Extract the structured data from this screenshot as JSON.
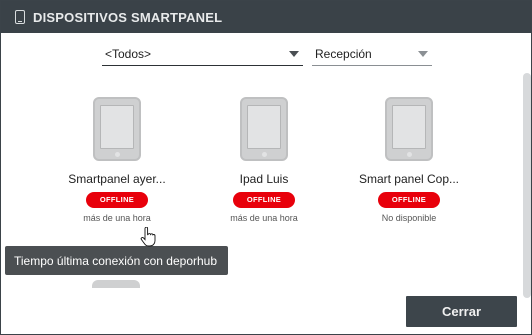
{
  "window": {
    "title": "DISPOSITIVOS SMARTPANEL",
    "title_icon": "tablet-icon"
  },
  "filters": {
    "group_selected": "<Todos>",
    "location_selected": "Recepción"
  },
  "devices": [
    {
      "name": "Smartpanel ayer...",
      "status": "OFFLINE",
      "last_connection": "más de una hora"
    },
    {
      "name": "Ipad Luis",
      "status": "OFFLINE",
      "last_connection": "más de una hora"
    },
    {
      "name": "Smart panel Cop...",
      "status": "OFFLINE",
      "last_connection": "No disponible"
    }
  ],
  "tooltip": {
    "text": "Tiempo última conexión con deporhub"
  },
  "footer": {
    "close_label": "Cerrar"
  },
  "colors": {
    "titlebar": "#3a4248",
    "offline_badge": "#e8000b",
    "tooltip_bg": "#4b4f52",
    "button_bg": "#3d454b"
  }
}
